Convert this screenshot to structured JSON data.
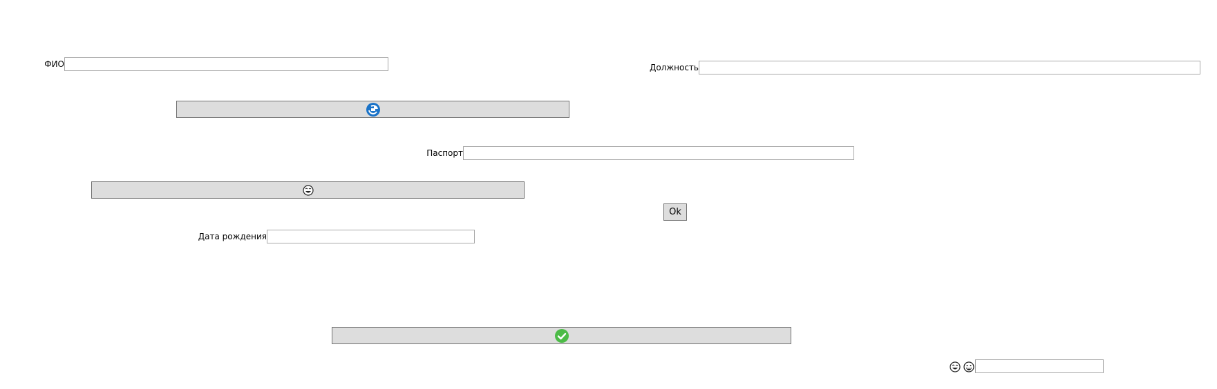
{
  "form": {
    "fio_label": "ФИО",
    "fio_value": "",
    "position_label": "Должность",
    "position_value": "",
    "passport_label": "Паспорт",
    "passport_value": "",
    "birthdate_label": "Дата рождения",
    "birthdate_value": "",
    "extra_value": ""
  },
  "buttons": {
    "ok_label": "Ok",
    "sync_icon": "blue-sync-icon",
    "emoji_icon": "laughing-face-icon",
    "confirm_icon": "green-check-circle-icon",
    "extra_icons": [
      "laughing-face-icon",
      "grinning-face-icon"
    ]
  },
  "colors": {
    "button_bg": "#dddddd",
    "button_border": "#707070",
    "field_border": "#a8a8a8",
    "accent_blue": "#1a73c8",
    "accent_green": "#4cbb47"
  }
}
